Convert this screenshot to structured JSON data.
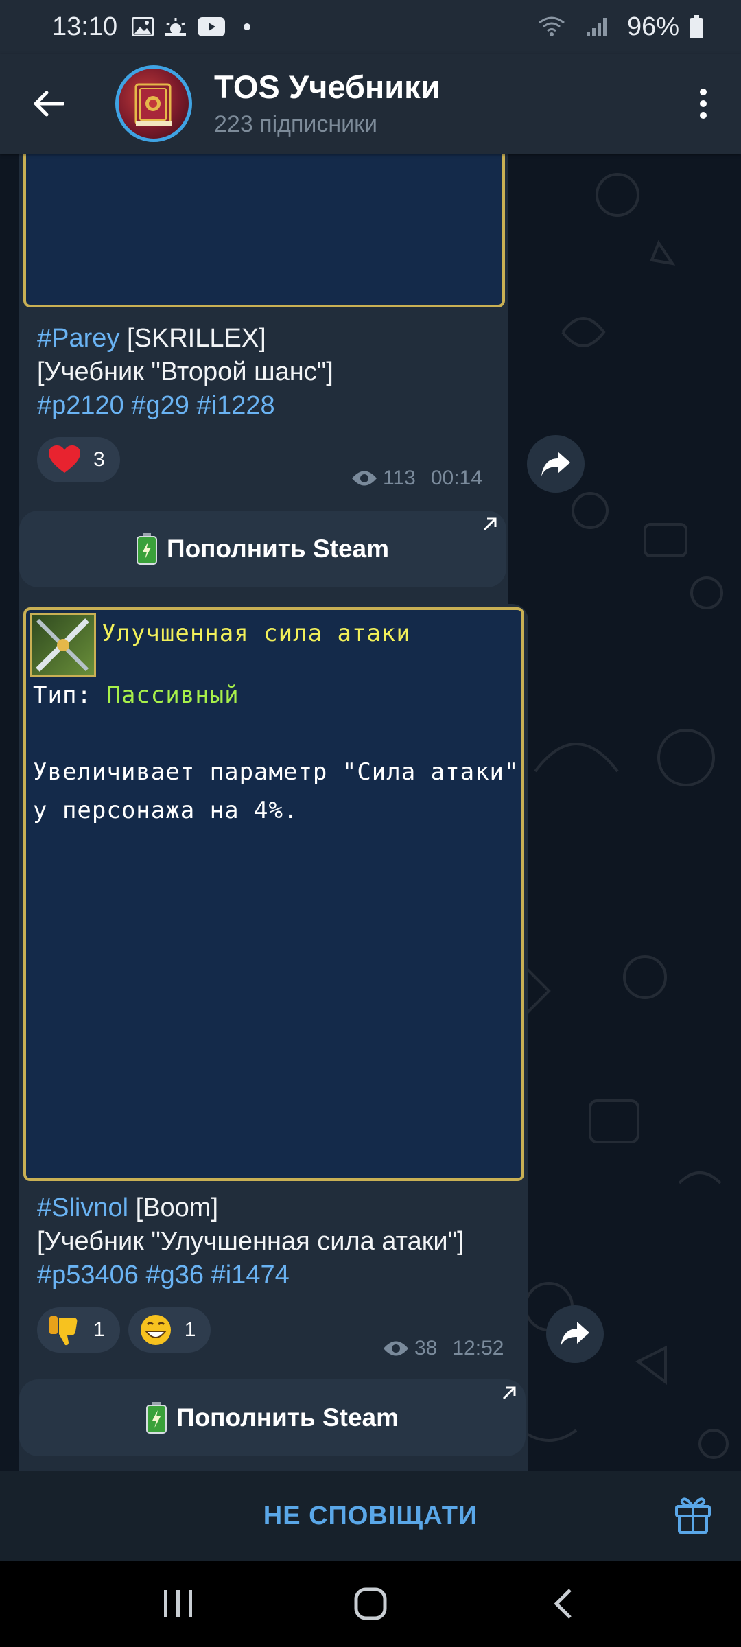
{
  "status_bar": {
    "time": "13:10",
    "battery": "96%",
    "icons": [
      "gallery-icon",
      "weather-icon",
      "youtube-icon",
      "dot-icon",
      "wifi-icon",
      "signal-icon",
      "battery-icon"
    ]
  },
  "header": {
    "title": "TOS Учебники",
    "subtitle": "223 підписники"
  },
  "messages": [
    {
      "caption_tag": "#Parey",
      "caption_author": " [SKRILLEX]",
      "caption_line2": "[Учебник \"Второй шанс\"]",
      "caption_tags": [
        "#p2120",
        "#g29",
        "#i1228"
      ],
      "reactions": [
        {
          "emoji": "heart",
          "count": "3"
        }
      ],
      "views": "113",
      "time": "00:14",
      "button": "Пополнить Steam"
    },
    {
      "image": {
        "skill_name": "Улучшенная сила атаки",
        "type_label": "Тип:",
        "type_value": "Пассивный",
        "desc_line1": "Увеличивает параметр \"Сила атаки\"",
        "desc_line2": "у персонажа на 4%."
      },
      "caption_tag": "#Slivnol",
      "caption_author": " [Boom]",
      "caption_line2": "[Учебник \"Улучшенная сила атаки\"]",
      "caption_tags": [
        "#p53406",
        "#g36",
        "#i1474"
      ],
      "reactions": [
        {
          "emoji": "thumbs-down",
          "count": "1"
        },
        {
          "emoji": "grin",
          "count": "1"
        }
      ],
      "views": "38",
      "time": "12:52",
      "button": "Пополнить Steam"
    }
  ],
  "bottom": {
    "mute_label": "НЕ СПОВІЩАТИ"
  },
  "colors": {
    "accent": "#6ab3f3",
    "bubble": "#212d3b",
    "header": "#212b37",
    "gold": "#c9b054",
    "skill_title": "#f2f05a",
    "skill_type": "#a8f04a"
  }
}
